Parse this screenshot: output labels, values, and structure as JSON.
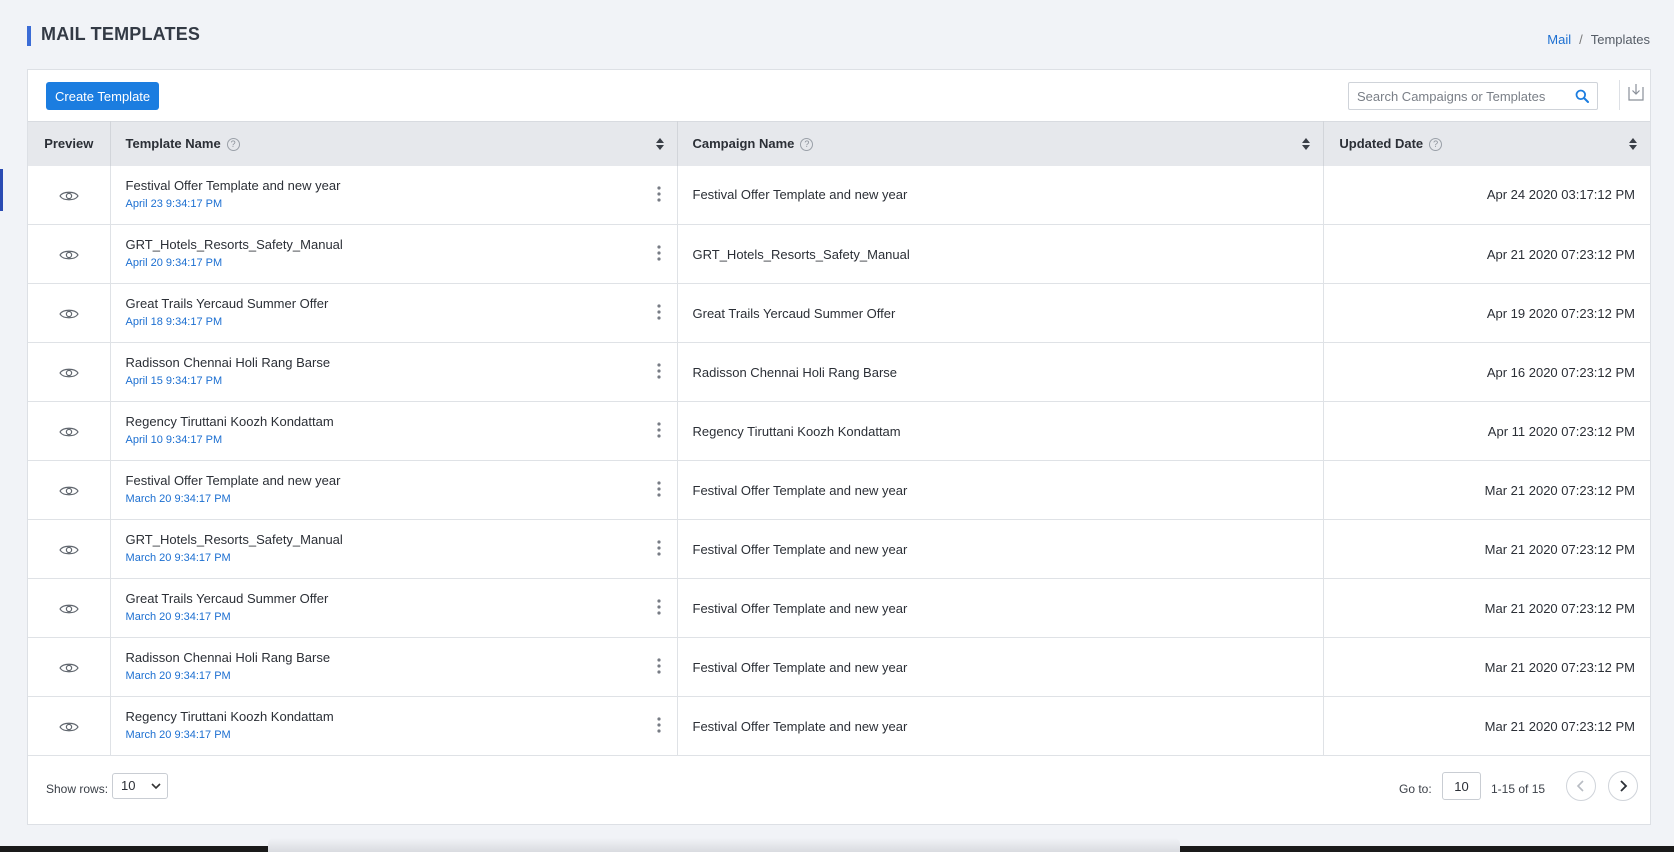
{
  "header": {
    "title": "MAIL TEMPLATES",
    "breadcrumb": {
      "link": "Mail",
      "separator": "/",
      "current": "Templates"
    }
  },
  "toolbar": {
    "create_label": "Create Template",
    "search_placeholder": "Search Campaigns or Templates"
  },
  "table": {
    "columns": {
      "preview": "Preview",
      "template_name": "Template Name",
      "campaign_name": "Campaign Name",
      "updated_date": "Updated Date"
    },
    "help_glyph": "?",
    "rows": [
      {
        "template": "Festival Offer Template and new year",
        "created": "April 23 9:34:17 PM",
        "campaign": "Festival Offer Template and new year",
        "updated": "Apr 24 2020 03:17:12 PM"
      },
      {
        "template": "GRT_Hotels_Resorts_Safety_Manual",
        "created": "April 20 9:34:17 PM",
        "campaign": "GRT_Hotels_Resorts_Safety_Manual",
        "updated": "Apr 21 2020 07:23:12 PM"
      },
      {
        "template": "Great Trails Yercaud Summer Offer",
        "created": "April 18 9:34:17 PM",
        "campaign": "Great Trails Yercaud Summer Offer",
        "updated": "Apr 19 2020 07:23:12 PM"
      },
      {
        "template": "Radisson Chennai Holi Rang Barse",
        "created": "April 15 9:34:17 PM",
        "campaign": "Radisson Chennai Holi Rang Barse",
        "updated": "Apr 16 2020 07:23:12 PM"
      },
      {
        "template": "Regency Tiruttani Koozh Kondattam",
        "created": "April 10 9:34:17 PM",
        "campaign": "Regency Tiruttani Koozh Kondattam",
        "updated": "Apr 11 2020 07:23:12 PM"
      },
      {
        "template": "Festival Offer Template and new year",
        "created": "March 20 9:34:17 PM",
        "campaign": "Festival Offer Template and new year",
        "updated": "Mar 21 2020 07:23:12 PM"
      },
      {
        "template": "GRT_Hotels_Resorts_Safety_Manual",
        "created": "March 20 9:34:17 PM",
        "campaign": "Festival Offer Template and new year",
        "updated": "Mar 21 2020 07:23:12 PM"
      },
      {
        "template": "Great Trails Yercaud Summer Offer",
        "created": "March 20 9:34:17 PM",
        "campaign": "Festival Offer Template and new year",
        "updated": "Mar 21 2020 07:23:12 PM"
      },
      {
        "template": "Radisson Chennai Holi Rang Barse",
        "created": "March 20 9:34:17 PM",
        "campaign": "Festival Offer Template and new year",
        "updated": "Mar 21 2020 07:23:12 PM"
      },
      {
        "template": "Regency Tiruttani Koozh Kondattam",
        "created": "March 20 9:34:17 PM",
        "campaign": "Festival Offer Template and new year",
        "updated": "Mar 21 2020 07:23:12 PM"
      }
    ]
  },
  "footer": {
    "show_rows_label": "Show rows:",
    "rows_value": "10",
    "goto_label": "Go to:",
    "goto_value": "10",
    "page_range": "1-15 of 15"
  },
  "icons": {
    "preview": "eye-icon",
    "row_actions": "kebab-menu-icon",
    "search": "search-icon",
    "download": "download-icon",
    "sort": "sort-icon",
    "help": "help-icon",
    "prev": "chevron-left-icon",
    "next": "chevron-right-icon"
  },
  "colors": {
    "accent": "#1b7de0",
    "link": "#1c6fd1",
    "title_bar": "#3b6cd6",
    "header_bg": "#e6e8ec",
    "page_bg": "#f1f3f7"
  }
}
